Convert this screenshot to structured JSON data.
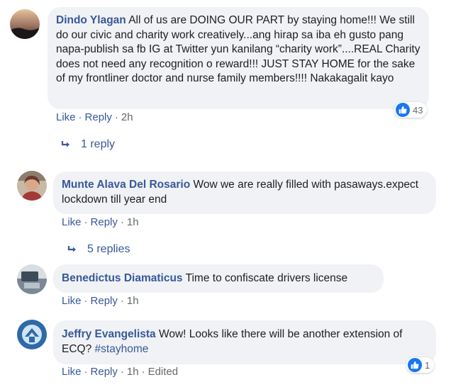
{
  "comments": [
    {
      "author": "Dindo Ylagan",
      "text": "All of us are DOING OUR PART by staying home!!! We still do our civic and charity work creatively...ang hirap sa iba eh gusto pang napa-publish sa fb IG at Twitter yun kanilang “charity work”....REAL Charity does not need any recognition o reward!!! JUST STAY HOME for the sake of my frontliner doctor and nurse family members!!!! Nakakagalit kayo",
      "like_label": "Like",
      "reply_label": "Reply",
      "time": "2h",
      "reaction_count": "43",
      "replies_label": "1 reply"
    },
    {
      "author": "Munte Alava Del Rosario",
      "text": "Wow we are really filled with pasaways.expect lockdown till year end",
      "like_label": "Like",
      "reply_label": "Reply",
      "time": "1h",
      "replies_label": "5 replies"
    },
    {
      "author": "Benedictus Diamaticus",
      "text": "Time to confiscate drivers license",
      "like_label": "Like",
      "reply_label": "Reply",
      "time": "1h"
    },
    {
      "author": "Jeffry Evangelista",
      "text": "Wow! Looks like there will be another extension of ECQ?",
      "hashtag": "#stayhome",
      "like_label": "Like",
      "reply_label": "Reply",
      "time": "1h",
      "edited_label": "Edited",
      "reaction_count": "1"
    }
  ],
  "colors": {
    "author": "#385898",
    "bubble": "#f0f2f5",
    "like_blue": "#1877f2",
    "meta_gray": "#65676b"
  },
  "icons": [
    "thumbs-up-icon",
    "reply-arrow-icon"
  ]
}
